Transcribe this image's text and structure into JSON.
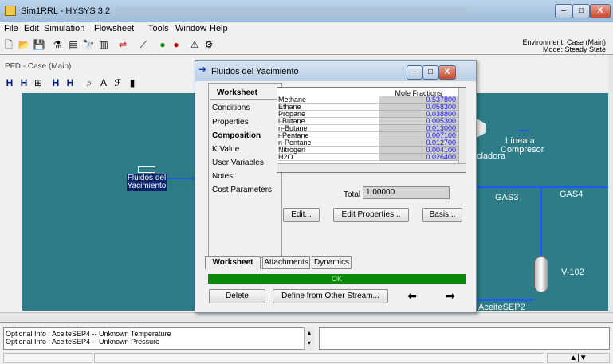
{
  "app": {
    "title": "Sim1RRL - HYSYS 3.2"
  },
  "window_controls": {
    "minimize": "–",
    "maximize": "□",
    "close": "X"
  },
  "menu": [
    "File",
    "Edit",
    "Simulation",
    "Flowsheet",
    "Tools",
    "Window",
    "Help"
  ],
  "environment": {
    "line1": "Environment: Case (Main)",
    "line2": "Mode: Steady State"
  },
  "pfd": {
    "title": "PFD - Case (Main)",
    "labels": {
      "fluidos_line1": "Fluidos del",
      "fluidos_line2": "Yacimiento",
      "linea_line1": "Línea a",
      "linea_line2": "Compresor",
      "cladora": "cladora",
      "gas3": "GAS3",
      "gas4": "GAS4",
      "v102": "V-102",
      "aceite": "AceiteSEP2"
    }
  },
  "dialog": {
    "title": "Fluidos del Yacimiento",
    "nav": [
      {
        "label": "Worksheet",
        "bold": true
      },
      {
        "label": "Conditions",
        "bold": false
      },
      {
        "label": "Properties",
        "bold": false
      },
      {
        "label": "Composition",
        "bold": true
      },
      {
        "label": "K Value",
        "bold": false
      },
      {
        "label": "User Variables",
        "bold": false
      },
      {
        "label": "Notes",
        "bold": false
      },
      {
        "label": "Cost Parameters",
        "bold": false
      }
    ],
    "grid_header": "Mole Fractions",
    "components": [
      {
        "name": "Methane",
        "value": "0.537800"
      },
      {
        "name": "Ethane",
        "value": "0.058300"
      },
      {
        "name": "Propane",
        "value": "0.038800"
      },
      {
        "name": "i-Butane",
        "value": "0.005300"
      },
      {
        "name": "n-Butane",
        "value": "0.013000"
      },
      {
        "name": "i-Pentane",
        "value": "0.007100"
      },
      {
        "name": "n-Pentane",
        "value": "0.012700"
      },
      {
        "name": "Nitrogen",
        "value": "0.004100"
      },
      {
        "name": "H2O",
        "value": "0.026400"
      }
    ],
    "total_label": "Total",
    "total_value": "1.00000",
    "buttons": {
      "edit": "Edit...",
      "edit_properties": "Edit Properties...",
      "basis": "Basis..."
    },
    "tabs": [
      "Worksheet",
      "Attachments",
      "Dynamics"
    ],
    "status_ok": "OK",
    "delete": "Delete",
    "define_from": "Define from Other Stream..."
  },
  "status": {
    "line1": "Optional Info : AceiteSEP4 -- Unknown Temperature",
    "line2": "Optional Info : AceiteSEP4 -- Unknown Pressure"
  },
  "colors": {
    "pfd_background": "#2e7c87",
    "ok_bar": "#0a8a0a",
    "selection": "#0a246a"
  }
}
